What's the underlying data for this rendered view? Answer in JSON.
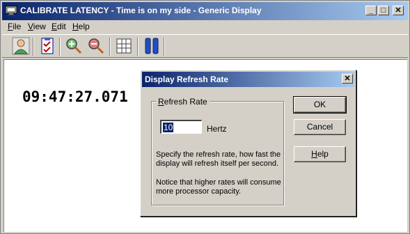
{
  "window": {
    "title": "CALIBRATE LATENCY - Time is on my side  - Generic Display",
    "min_glyph": "_",
    "max_glyph": "□",
    "close_glyph": "✕"
  },
  "menu": {
    "items": [
      {
        "u": "F",
        "rest": "ile"
      },
      {
        "u": "V",
        "rest": "iew"
      },
      {
        "u": "E",
        "rest": "dit"
      },
      {
        "u": "H",
        "rest": "elp"
      }
    ]
  },
  "toolbar": {
    "icons": [
      "user-icon",
      "checklist-icon",
      "zoom-in-icon",
      "zoom-out-icon",
      "grid-icon",
      "pause-icon"
    ]
  },
  "display": {
    "clock": "09:47:27.071"
  },
  "dialog": {
    "title": "Display Refresh Rate",
    "close_glyph": "✕",
    "group_label_u": "R",
    "group_label_rest": "efresh Rate",
    "rate_value": "10",
    "unit": "Hertz",
    "desc1": "Specify the refresh rate, how fast the display will refresh itself per second.",
    "desc2": "Notice that higher rates will consume more processor capacity.",
    "ok_label": "OK",
    "cancel_label": "Cancel",
    "help_u": "H",
    "help_rest": "elp"
  },
  "colors": {
    "title_active": "#0a246a",
    "title_gradient_end": "#a6caf0",
    "face": "#d4d0c8"
  }
}
